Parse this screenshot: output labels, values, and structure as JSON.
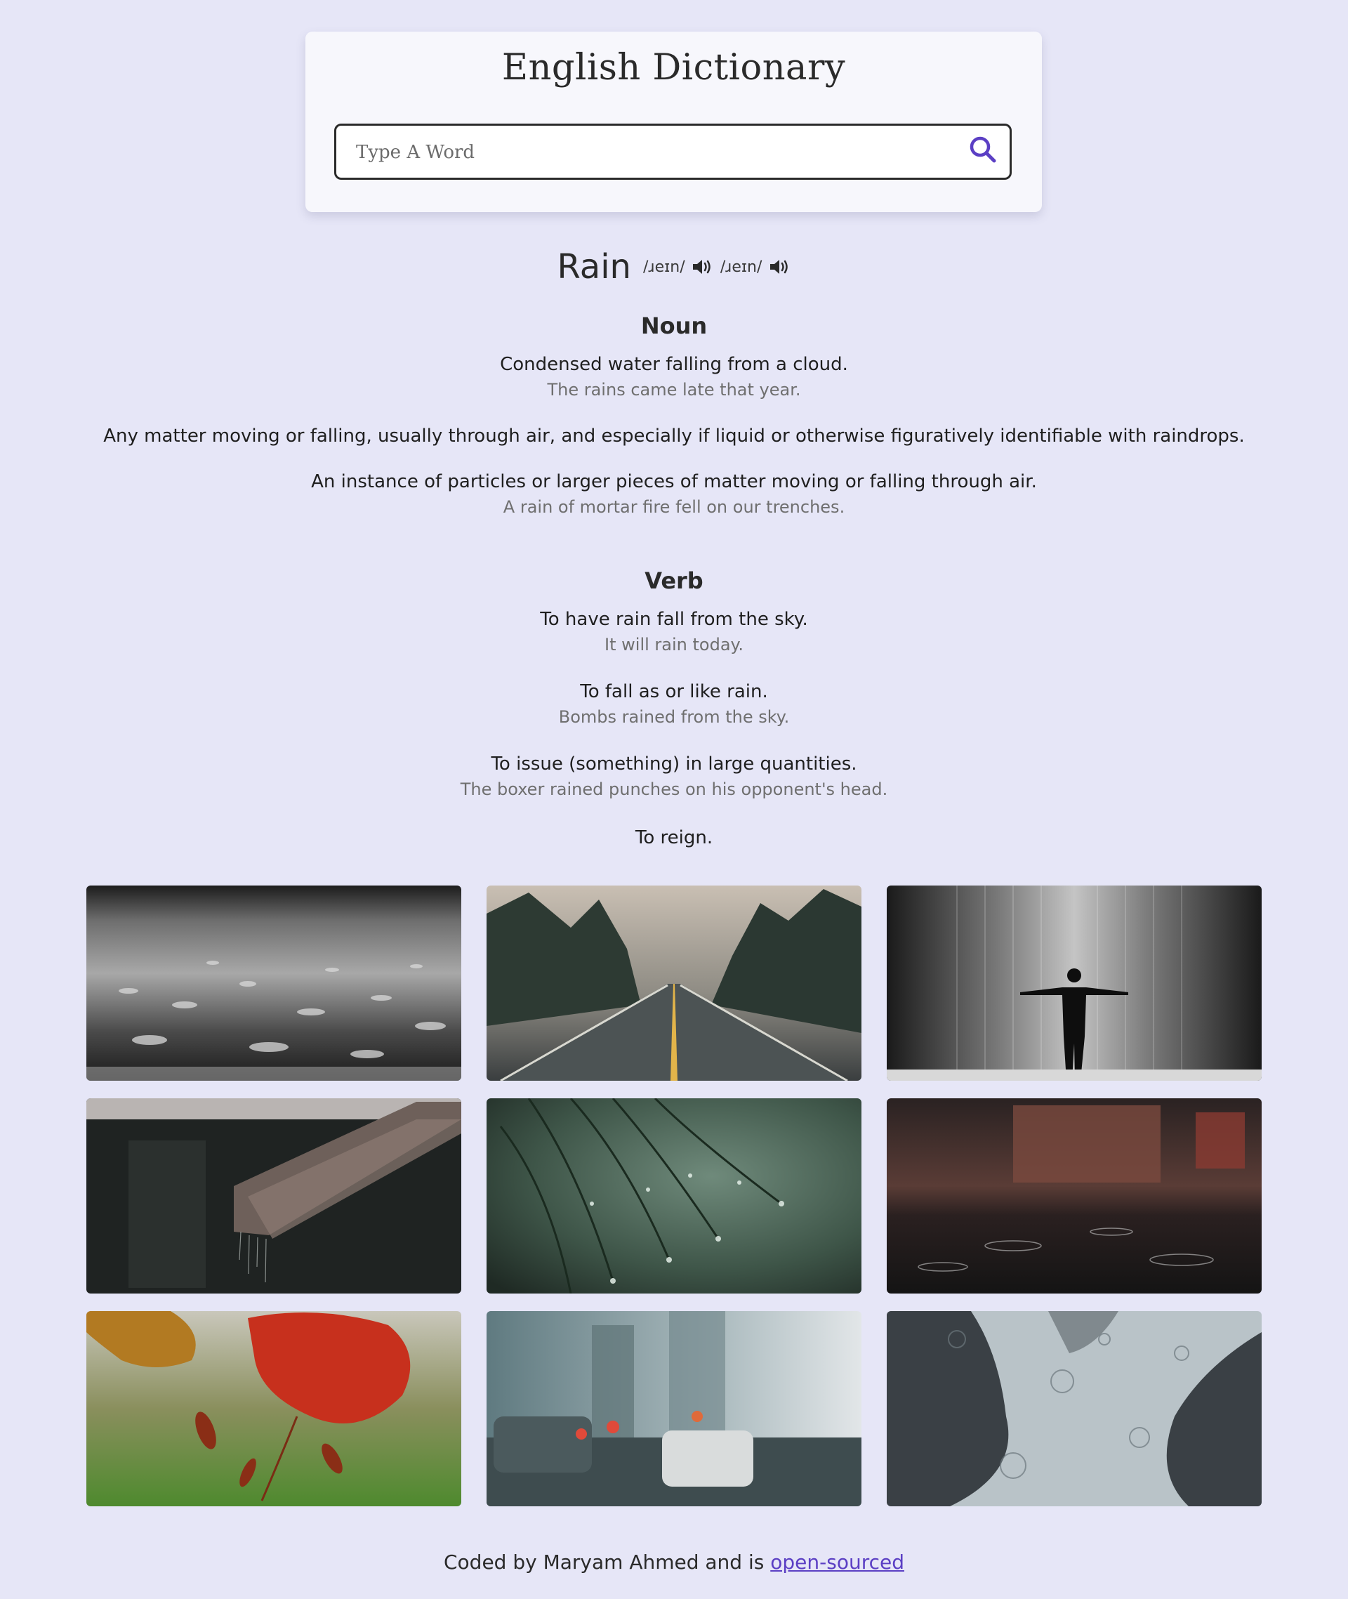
{
  "header": {
    "title": "English Dictionary"
  },
  "search": {
    "placeholder": "Type A Word",
    "value": ""
  },
  "result": {
    "word": "Rain",
    "phonetics": [
      {
        "text": "/ɹeɪn/"
      },
      {
        "text": "/ɹeɪn/"
      }
    ],
    "meanings": [
      {
        "part_of_speech": "Noun",
        "definitions": [
          {
            "definition": "Condensed water falling from a cloud.",
            "example": "The rains came late that year."
          },
          {
            "definition": "Any matter moving or falling, usually through air, and especially if liquid or otherwise figuratively identifiable with raindrops.",
            "example": ""
          },
          {
            "definition": "An instance of particles or larger pieces of matter moving or falling through air.",
            "example": "A rain of mortar fire fell on our trenches."
          }
        ]
      },
      {
        "part_of_speech": "Verb",
        "definitions": [
          {
            "definition": "To have rain fall from the sky.",
            "example": "It will rain today."
          },
          {
            "definition": "To fall as or like rain.",
            "example": "Bombs rained from the sky."
          },
          {
            "definition": "To issue (something) in large quantities.",
            "example": "The boxer rained punches on his opponent's head."
          },
          {
            "definition": "To reign.",
            "example": ""
          }
        ]
      }
    ]
  },
  "gallery": {
    "images": [
      {
        "subject": "raindrops splashing on ground"
      },
      {
        "subject": "wet road through misty forest"
      },
      {
        "subject": "silhouette under rain curtain"
      },
      {
        "subject": "rain dripping from roof edge"
      },
      {
        "subject": "water droplets on pine needles"
      },
      {
        "subject": "rain ripples on street puddle"
      },
      {
        "subject": "red autumn leaves behind wet glass"
      },
      {
        "subject": "city traffic through rainy window"
      },
      {
        "subject": "rain ripples on dark water"
      }
    ]
  },
  "footer": {
    "text": "Coded by Maryam Ahmed and is ",
    "link_text": "open-sourced"
  },
  "colors": {
    "background": "#e6e6f7",
    "accent": "#5b3fc4",
    "card": "#f7f7fc"
  }
}
